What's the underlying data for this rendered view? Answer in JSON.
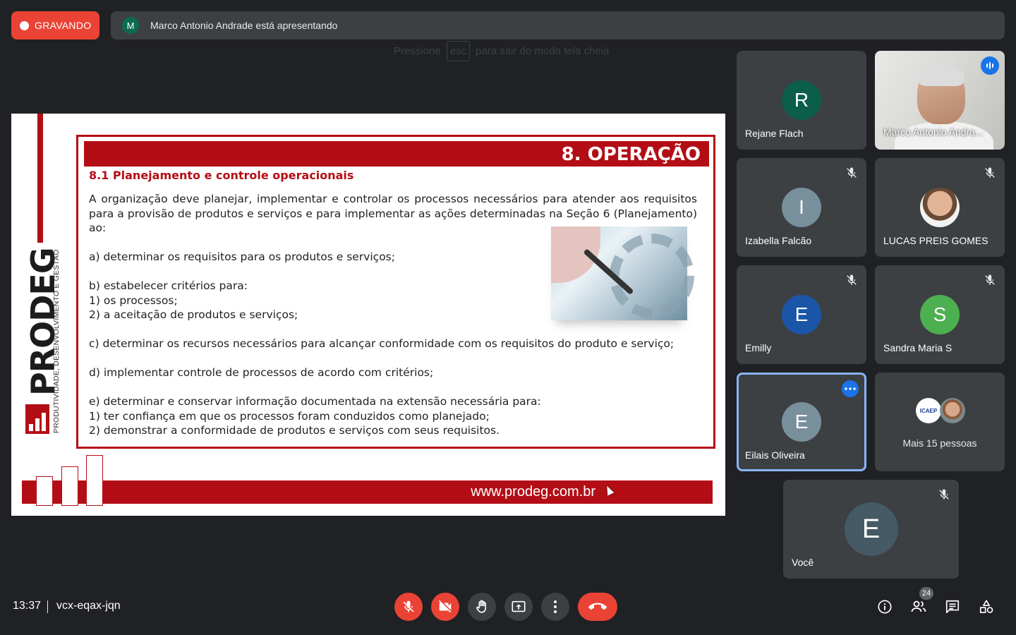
{
  "recording": {
    "label": "GRAVANDO"
  },
  "presenter": {
    "initial": "M",
    "text": "Marco Antonio Andrade está apresentando"
  },
  "fullscreen_hint": {
    "before": "Pressione",
    "key": "esc",
    "after": "para sair do modo tela cheia"
  },
  "slide": {
    "logo_word": "PRODEG",
    "logo_subtitle": "PRODUTIVIDADE, DESENVOLVIMENTO E GESTÃO",
    "header_title": "8. OPERAÇÃO",
    "subtitle": "8.1 Planejamento e controle operacionais",
    "intro": "A organização deve planejar, implementar e controlar os processos necessários para atender aos requisitos para a provisão de produtos e serviços e para implementar as ações determinadas na Seção 6 (Planejamento) ao:",
    "item_a": "a) determinar os requisitos para os produtos e serviços;",
    "item_b": "b) estabelecer critérios para:",
    "item_b1": "1) os processos;",
    "item_b2": "2) a aceitação de produtos e serviços;",
    "item_c": "c) determinar os recursos necessários para alcançar conformidade com os requisitos do produto e serviço;",
    "item_d": "d) implementar controle de processos de acordo com critérios;",
    "item_e": "e) determinar e conservar informação documentada na extensão necessária para:",
    "item_e1": "1) ter confiança em que os processos foram conduzidos como planejado;",
    "item_e2": "2) demonstrar a conformidade de produtos e serviços com seus requisitos.",
    "footer_url": "www.prodeg.com.br"
  },
  "participants": [
    {
      "name": "Rejane Flach",
      "initial": "R",
      "color": "#0b5e4a",
      "muted": false
    },
    {
      "name": "Marco Antonio Andra...",
      "video": true,
      "speaking": true
    },
    {
      "name": "Izabella Falcão",
      "initial": "I",
      "color": "#78909c",
      "muted": true
    },
    {
      "name": "LUCAS PREIS GOMES",
      "photo": true,
      "muted": true
    },
    {
      "name": "Emilly",
      "initial": "E",
      "color": "#1a55a8",
      "muted": true
    },
    {
      "name": "Sandra Maria S",
      "initial": "S",
      "color": "#4caf50",
      "muted": true
    },
    {
      "name": "Eilais Oliveira",
      "initial": "E",
      "color": "#78909c",
      "active": true
    },
    {
      "more_label": "Mais 15 pessoas",
      "avatar_text": "ICAEP"
    },
    {
      "name": "Você",
      "initial": "E",
      "color": "#455a64",
      "muted": true
    }
  ],
  "bottom": {
    "time": "13:37",
    "meeting_code": "vcx-eqax-jqn",
    "participant_count": "24"
  },
  "icons": [
    "mic-off-icon",
    "camera-off-icon",
    "raise-hand-icon",
    "present-icon",
    "more-options-icon",
    "end-call-icon",
    "info-icon",
    "people-icon",
    "chat-icon",
    "activities-icon"
  ],
  "colors": {
    "brand_red": "#b30e16",
    "meet_red": "#ea4335",
    "tile_bg": "#3c4043",
    "page_bg": "#202124",
    "accent_blue": "#1a73e8"
  }
}
